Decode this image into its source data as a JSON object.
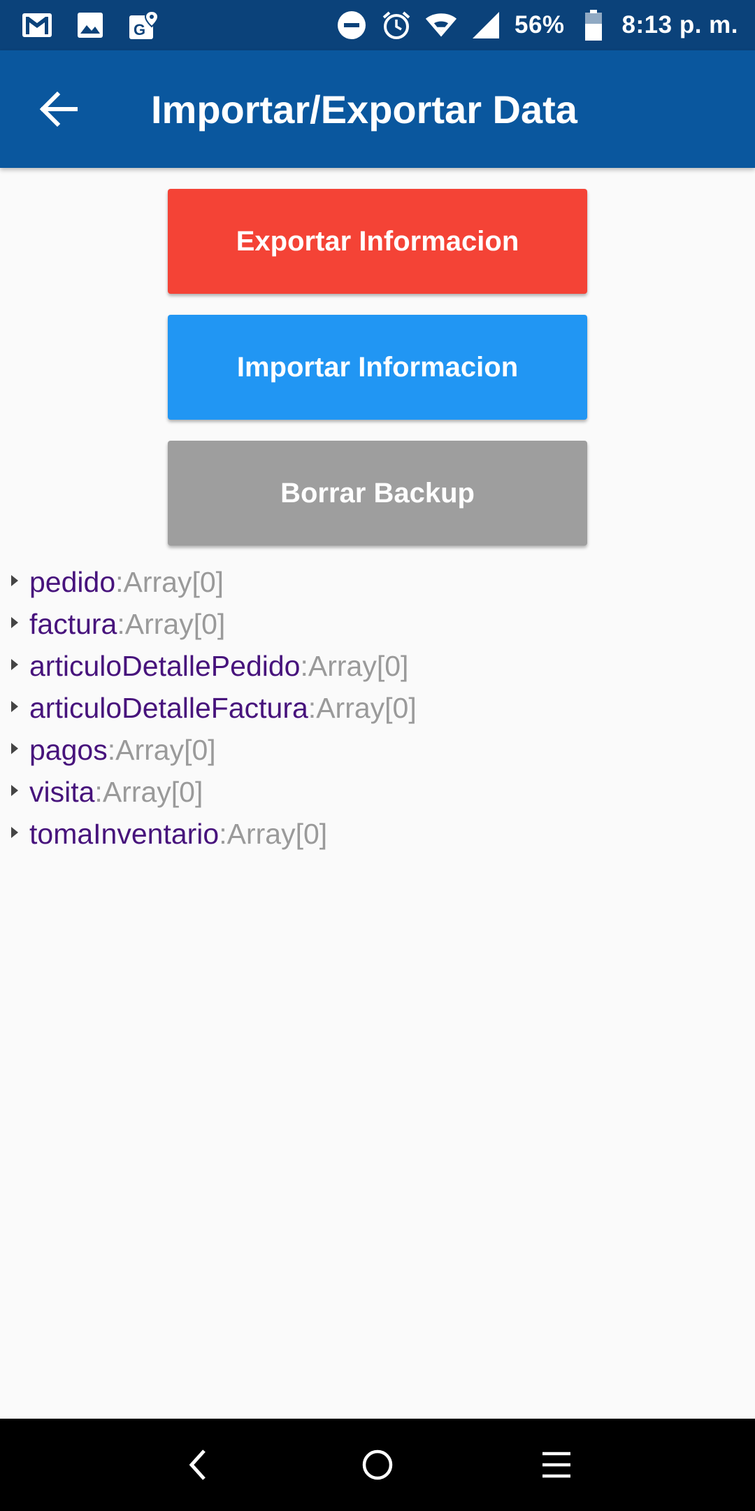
{
  "status_bar": {
    "battery": "56%",
    "time": "8:13 p. m.",
    "left_icons": [
      "gmail-icon",
      "gallery-icon",
      "maps-icon"
    ],
    "right_icons": [
      "do-not-disturb-icon",
      "alarm-icon",
      "wifi-icon",
      "signal-icon",
      "battery-icon"
    ]
  },
  "app_bar": {
    "title": "Importar/Exportar Data",
    "back_icon": "arrow-back-icon"
  },
  "buttons": {
    "export": "Exportar Informacion",
    "import": "Importar Informacion",
    "delete": "Borrar Backup"
  },
  "tree": [
    {
      "key": "pedido",
      "value": "Array[0]"
    },
    {
      "key": "factura",
      "value": "Array[0]"
    },
    {
      "key": "articuloDetallePedido",
      "value": "Array[0]"
    },
    {
      "key": "articuloDetalleFactura",
      "value": "Array[0]"
    },
    {
      "key": "pagos",
      "value": "Array[0]"
    },
    {
      "key": "visita",
      "value": "Array[0]"
    },
    {
      "key": "tomaInventario",
      "value": "Array[0]"
    }
  ],
  "tree_separator": ": ",
  "colors": {
    "status_bar": "#0b427a",
    "app_bar": "#0a579e",
    "export_button": "#f44336",
    "import_button": "#2196f3",
    "delete_button": "#9e9e9e",
    "tree_key": "#47137c",
    "tree_value": "#9a9a9a"
  }
}
